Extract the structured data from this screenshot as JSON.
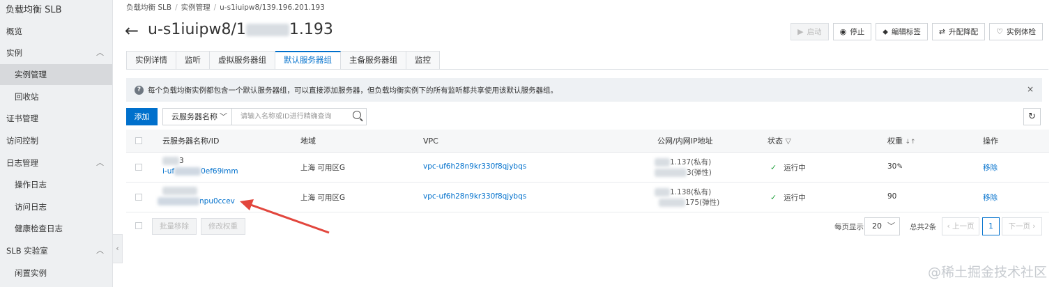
{
  "sidebar": {
    "title": "负载均衡 SLB",
    "items": [
      {
        "label": "概览"
      },
      {
        "label": "实例"
      },
      {
        "label": "实例管理"
      },
      {
        "label": "回收站"
      },
      {
        "label": "证书管理"
      },
      {
        "label": "访问控制"
      },
      {
        "label": "日志管理"
      },
      {
        "label": "操作日志"
      },
      {
        "label": "访问日志"
      },
      {
        "label": "健康检查日志"
      },
      {
        "label": "SLB 实验室"
      },
      {
        "label": "闲置实例"
      }
    ],
    "collapse": "‹"
  },
  "breadcrumb": [
    "负载均衡 SLB",
    "实例管理",
    "u-s1iuipw8/139.196.201.193"
  ],
  "header": {
    "back": "←",
    "title_visible": "u-s1iuipw8/1",
    "title_tail": "1.193",
    "buttons": [
      {
        "label": "启动",
        "icon": "▶",
        "disabled": true
      },
      {
        "label": "停止",
        "icon": "◉",
        "disabled": false
      },
      {
        "label": "编辑标签",
        "icon": "⬥",
        "disabled": false
      },
      {
        "label": "升配降配",
        "icon": "⇄",
        "disabled": false
      },
      {
        "label": "实例体检",
        "icon": "♡",
        "disabled": false
      }
    ]
  },
  "tabs": [
    "实例详情",
    "监听",
    "虚拟服务器组",
    "默认服务器组",
    "主备服务器组",
    "监控"
  ],
  "active_tab": "默认服务器组",
  "notice": {
    "icon": "?",
    "text": "每个负载均衡实例都包含一个默认服务器组，可以直接添加服务器，但负载均衡实例下的所有监听都共享使用该默认服务器组。",
    "close": "×"
  },
  "toolbar": {
    "add_label": "添加",
    "select_value": "云服务器名称",
    "search_placeholder": "请输入名称或ID进行精确查询",
    "refresh": "↻"
  },
  "table": {
    "headers": [
      "云服务器名称/ID",
      "地域",
      "VPC",
      "公网/内网IP地址",
      "状态",
      "权重",
      "操作"
    ],
    "rows": [
      {
        "name_tail": "3",
        "id_prefix": "i-uf",
        "id_tail": "0ef69imm",
        "region": "上海 可用区G",
        "vpc": "vpc-uf6h28n9kr330f8qjybqs",
        "ip1": "1.137(私有)",
        "ip2": "3(弹性)",
        "status": "运行中",
        "weight": "30",
        "action": "移除"
      },
      {
        "name_tail": "",
        "id_prefix": "",
        "id_tail": "npu0ccev",
        "region": "上海 可用区G",
        "vpc": "vpc-uf6h28n9kr330f8qjybqs",
        "ip1": "1.138(私有)",
        "ip2": "175(弹性)",
        "status": "运行中",
        "weight": "90",
        "action": "移除"
      }
    ],
    "edit_icon": "✎",
    "sort_icon": "↓↑",
    "filter_icon": "▽"
  },
  "footer": {
    "batch_remove": "批量移除",
    "modify_weight": "修改权重",
    "per_page_label": "每页显示",
    "per_page": "20",
    "total": "总共2条",
    "prev": "上一页",
    "page": "1",
    "next": "下一页"
  },
  "watermark": "@稀土掘金技术社区",
  "colors": {
    "accent": "#0070cc",
    "success": "#21a03d",
    "annotation_arrow": "#e2463d"
  }
}
